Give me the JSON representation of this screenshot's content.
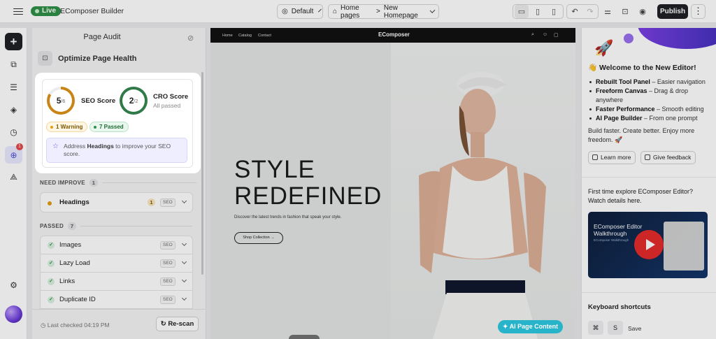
{
  "topbar": {
    "live_label": "Live",
    "app_name": "EComposer Builder",
    "template_select": "Default",
    "page_select_prefix": "Home pages",
    "page_select_arrow": ">",
    "page_select_value": "New Homepage",
    "publish_label": "Publish",
    "more_label": "⋮"
  },
  "rail": {
    "notification_count": "1"
  },
  "panel": {
    "title": "Page Audit",
    "subtitle": "Optimize Page Health",
    "seo": {
      "score": "5",
      "total": "/6",
      "label": "SEO Score",
      "progress": 0.833
    },
    "cro": {
      "score": "2",
      "total": "/2",
      "label": "CRO Score",
      "status": "All passed",
      "progress": 1.0
    },
    "warning_pill": "1 Warning",
    "passed_pill": "7 Passed",
    "tip_pre": "Address ",
    "tip_bold": "Headings",
    "tip_post": " to improve your SEO score.",
    "need_improve_label": "NEED IMPROVE",
    "need_improve_count": "1",
    "need_items": [
      {
        "name": "Headings",
        "count": "1",
        "tag": "SEO"
      }
    ],
    "passed_label": "PASSED",
    "passed_count": "7",
    "passed_items": [
      {
        "name": "Images",
        "tag": "SEO"
      },
      {
        "name": "Lazy Load",
        "tag": "SEO"
      },
      {
        "name": "Links",
        "tag": "SEO"
      },
      {
        "name": "Duplicate ID",
        "tag": "SEO"
      }
    ],
    "last_checked": "Last checked 04:19 PM",
    "rescan_label": "Re-scan"
  },
  "canvas": {
    "nav_links": [
      "Home",
      "Catalog",
      "Contact"
    ],
    "brand": "EComposer",
    "headline_1": "STYLE",
    "headline_2": "REDEFINED",
    "description": "Discover the latest trends in fashion that speak your style.",
    "cta": "Shop Collection →",
    "ai_button": "✦ AI Page Content"
  },
  "right": {
    "welcome": "👋 Welcome to the New Editor!",
    "features": [
      {
        "bold": "Rebuilt Tool Panel",
        "rest": " – Easier navigation"
      },
      {
        "bold": "Freeform Canvas",
        "rest": " – Drag & drop anywhere"
      },
      {
        "bold": "Faster Performance",
        "rest": " – Smooth editing"
      },
      {
        "bold": "AI Page Builder",
        "rest": " – From one prompt"
      }
    ],
    "tagline": "Build faster. Create better. Enjoy more freedom. 🚀",
    "learn_more": "Learn more",
    "feedback": "Give feedback",
    "first_time": "First time explore EComposer Editor? Watch details here.",
    "video_title": "EComposer Editor Walkthrough",
    "video_sub": "EComposer Walkthrough",
    "shortcuts_title": "Keyboard shortcuts",
    "shortcut_keys": [
      "⌘",
      "S"
    ],
    "shortcut_action": "Save"
  },
  "colors": {
    "accent": "#4c4fd9",
    "live": "#2f8f46",
    "warning": "#e39b16",
    "ai": "#27b3c9"
  }
}
